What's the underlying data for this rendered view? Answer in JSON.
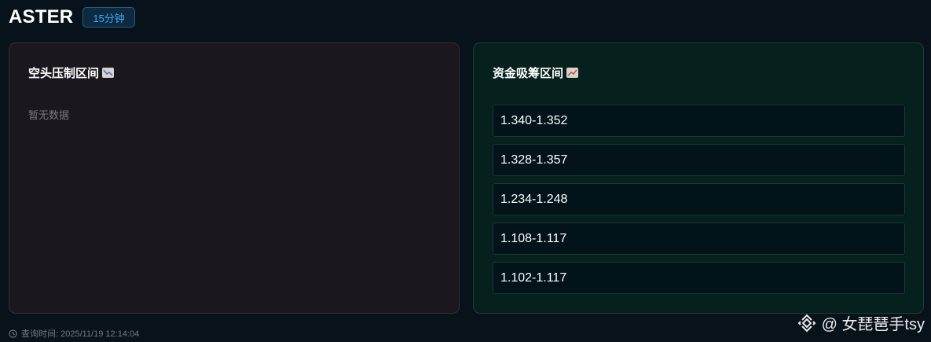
{
  "header": {
    "title": "ASTER",
    "timeframe_badge": "15分钟"
  },
  "short_panel": {
    "title": "空头压制区间",
    "icon": "chart-decreasing-icon",
    "empty_text": "暂无数据"
  },
  "accumulation_panel": {
    "title": "资金吸筹区间",
    "icon": "chart-increasing-icon",
    "ranges": [
      "1.340-1.352",
      "1.328-1.357",
      "1.234-1.248",
      "1.108-1.117",
      "1.102-1.117"
    ]
  },
  "footer": {
    "query_time": "查询时间: 2025/11/19 12:14:04",
    "icon": "clock-icon"
  },
  "watermark": {
    "text": "@ 女琵琶手tsy",
    "icon": "binance-logo-icon"
  },
  "colors": {
    "background": "#08121a",
    "badge": "#3fa9f5",
    "short_panel": "#1a171f",
    "accumulation_panel": "#05201d"
  }
}
